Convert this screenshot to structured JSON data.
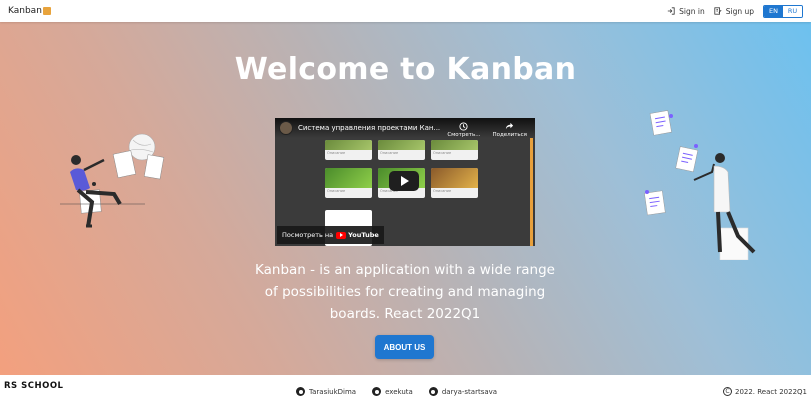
{
  "header": {
    "logo_text": "Kanban",
    "sign_in": "Sign in",
    "sign_up": "Sign up",
    "languages": [
      "EN",
      "RU"
    ],
    "active_language": "EN"
  },
  "hero": {
    "title": "Welcome to Kanban",
    "description": "Kanban - is an application with a wide range of possibilities for creating and managing boards. React 2022Q1",
    "about_button": "ABOUT US"
  },
  "video": {
    "title": "Система управления проектами Кан...",
    "watch_later": "Смотреть...",
    "share": "Поделиться",
    "watch_on": "Посмотреть на",
    "youtube_label": "YouTube"
  },
  "footer": {
    "school_logo": "RS SCHOOL",
    "github_users": [
      "TarasiukDima",
      "exekuta",
      "darya-startsava"
    ],
    "copyright": "2022. React 2022Q1"
  },
  "colors": {
    "accent": "#1f77d0",
    "gradient_left": "#f3a07e",
    "gradient_right": "#6dc1ef",
    "illustration_purple": "#7b61ff"
  }
}
